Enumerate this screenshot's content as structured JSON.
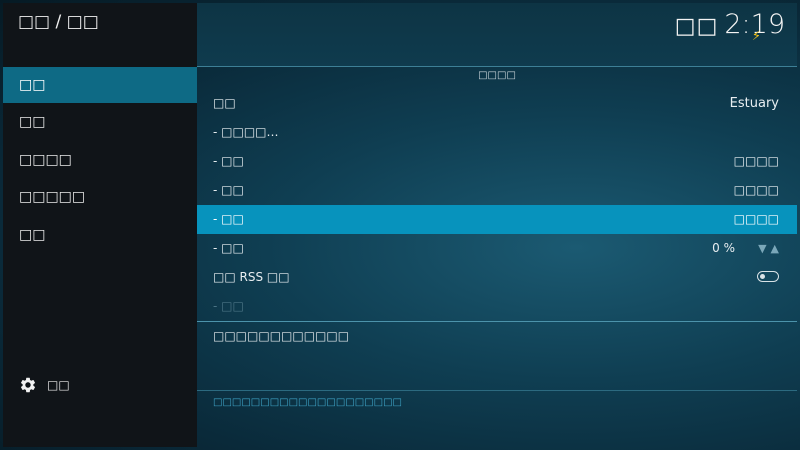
{
  "header": {
    "breadcrumb": "□□ / □□",
    "clock_prefix": "□□",
    "clock_time": "2:19",
    "bolt_icon": "lightning-bolt-icon"
  },
  "sidebar": {
    "items": [
      {
        "label": "□□",
        "active": true
      },
      {
        "label": "□□",
        "active": false
      },
      {
        "label": "□□□□",
        "active": false
      },
      {
        "label": "□□□□□",
        "active": false
      },
      {
        "label": "□□",
        "active": false
      }
    ],
    "settings_label": "□□"
  },
  "main": {
    "section_title": "□□□□",
    "rows": [
      {
        "label": "□□",
        "value": "Estuary"
      },
      {
        "label": "- □□□□…",
        "value": ""
      },
      {
        "label": "- □□",
        "value": "□□□□"
      },
      {
        "label": "- □□",
        "value": "□□□□"
      },
      {
        "label": "- □□",
        "value": "□□□□",
        "selected": true
      },
      {
        "label": "- □□",
        "value": "0 %"
      },
      {
        "label": "□□ RSS □□",
        "value": "",
        "toggle": false
      },
      {
        "label": "- □□",
        "value": "",
        "disabled": true
      }
    ],
    "description": "□□□□□□□□□□□□",
    "footer_hint": "□□□□□□□□□□□□□□□□□□□□"
  },
  "colors": {
    "accent_selected": "#0793bd",
    "sidebar_active": "#0e6a85",
    "background": "#0f3e52",
    "bolt": "#f2c21b"
  }
}
